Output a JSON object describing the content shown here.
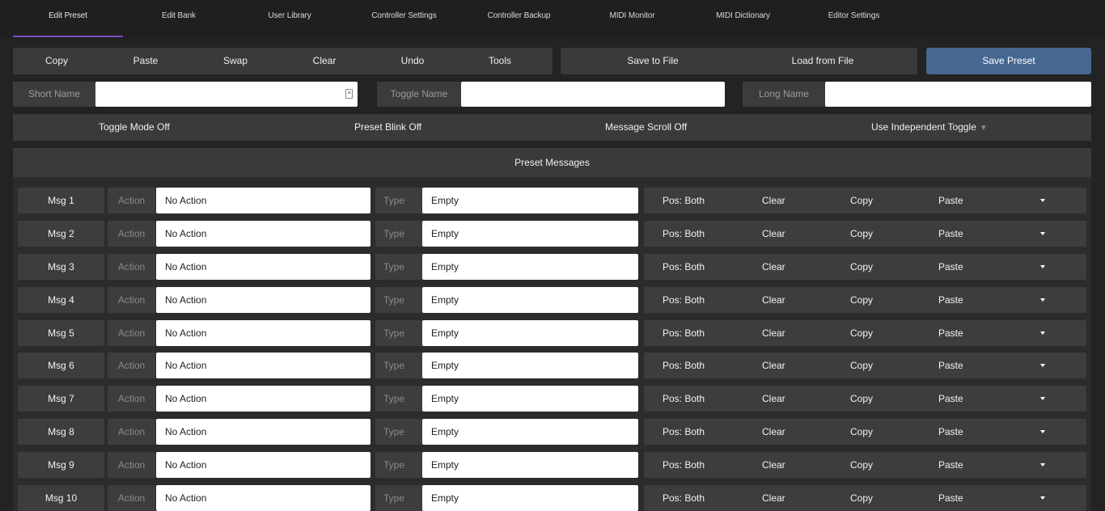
{
  "tabs": [
    {
      "label": "Edit Preset"
    },
    {
      "label": "Edit Bank"
    },
    {
      "label": "User Library"
    },
    {
      "label": "Controller Settings"
    },
    {
      "label": "Controller Backup"
    },
    {
      "label": "MIDI Monitor"
    },
    {
      "label": "MIDI Dictionary"
    },
    {
      "label": "Editor Settings"
    }
  ],
  "toolbar": {
    "copy": "Copy",
    "paste": "Paste",
    "swap": "Swap",
    "clear": "Clear",
    "undo": "Undo",
    "tools": "Tools",
    "save_to_file": "Save to File",
    "load_from_file": "Load from File",
    "save_preset": "Save Preset"
  },
  "names": {
    "short_label": "Short Name",
    "short_value": "",
    "toggle_label": "Toggle Name",
    "toggle_value": "",
    "long_label": "Long Name",
    "long_value": ""
  },
  "options": {
    "toggle_mode": "Toggle Mode Off",
    "preset_blink": "Preset Blink Off",
    "message_scroll": "Message Scroll Off",
    "independent_toggle": "Use Independent Toggle"
  },
  "preset_messages": {
    "title": "Preset Messages",
    "action_label": "Action",
    "type_label": "Type",
    "rows": [
      {
        "label": "Msg 1",
        "action": "No Action",
        "type": "Empty",
        "pos": "Pos: Both",
        "clear": "Clear",
        "copy": "Copy",
        "paste": "Paste"
      },
      {
        "label": "Msg 2",
        "action": "No Action",
        "type": "Empty",
        "pos": "Pos: Both",
        "clear": "Clear",
        "copy": "Copy",
        "paste": "Paste"
      },
      {
        "label": "Msg 3",
        "action": "No Action",
        "type": "Empty",
        "pos": "Pos: Both",
        "clear": "Clear",
        "copy": "Copy",
        "paste": "Paste"
      },
      {
        "label": "Msg 4",
        "action": "No Action",
        "type": "Empty",
        "pos": "Pos: Both",
        "clear": "Clear",
        "copy": "Copy",
        "paste": "Paste"
      },
      {
        "label": "Msg 5",
        "action": "No Action",
        "type": "Empty",
        "pos": "Pos: Both",
        "clear": "Clear",
        "copy": "Copy",
        "paste": "Paste"
      },
      {
        "label": "Msg 6",
        "action": "No Action",
        "type": "Empty",
        "pos": "Pos: Both",
        "clear": "Clear",
        "copy": "Copy",
        "paste": "Paste"
      },
      {
        "label": "Msg 7",
        "action": "No Action",
        "type": "Empty",
        "pos": "Pos: Both",
        "clear": "Clear",
        "copy": "Copy",
        "paste": "Paste"
      },
      {
        "label": "Msg 8",
        "action": "No Action",
        "type": "Empty",
        "pos": "Pos: Both",
        "clear": "Clear",
        "copy": "Copy",
        "paste": "Paste"
      },
      {
        "label": "Msg 9",
        "action": "No Action",
        "type": "Empty",
        "pos": "Pos: Both",
        "clear": "Clear",
        "copy": "Copy",
        "paste": "Paste"
      },
      {
        "label": "Msg 10",
        "action": "No Action",
        "type": "Empty",
        "pos": "Pos: Both",
        "clear": "Clear",
        "copy": "Copy",
        "paste": "Paste"
      }
    ]
  },
  "colors": {
    "accent_underline": "#7c4dc4",
    "save_button": "#466791",
    "background": "#232323"
  },
  "icons": {
    "short_name_field": "contact-card-icon",
    "independent_toggle": "triangle-down-icon",
    "row_menu": "caret-down-icon"
  }
}
